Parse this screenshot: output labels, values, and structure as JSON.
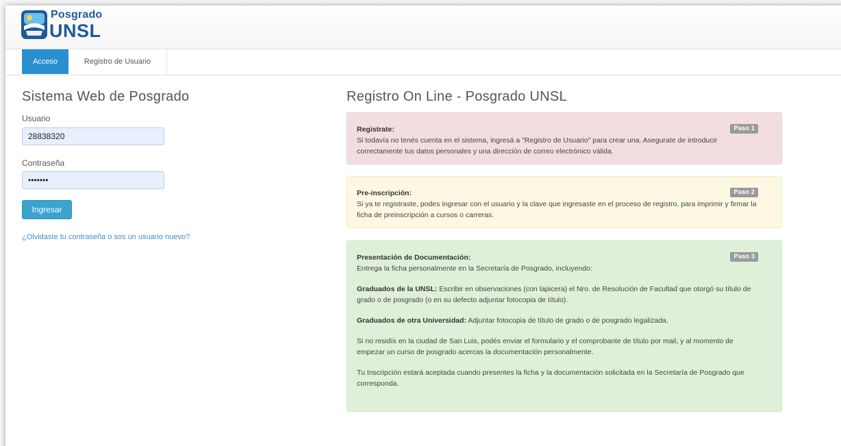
{
  "header": {
    "logo_top": "Posgrado",
    "logo_bottom": "UNSL"
  },
  "tabs": [
    {
      "label": "Acceso",
      "active": true
    },
    {
      "label": "Registro de Usuario",
      "active": false
    }
  ],
  "login": {
    "title": "Sistema Web de Posgrado",
    "user_label": "Usuario",
    "user_value": "28838320",
    "password_label": "Contraseña",
    "password_value": "•••••••",
    "submit_label": "Ingresar",
    "forgot_link": "¿Olvidaste tu contraseña o sos un usuario nuevo?"
  },
  "registro": {
    "title": "Registro On Line - Posgrado UNSL",
    "steps": [
      {
        "badge": "Paso 1",
        "title": "Registrate:",
        "text": "Si todavía no tenés cuenta en el sistema, ingresá a \"Registro de Usuario\" para crear una. Asegurate de introducir correctamente tus datos personales y una dirección de correo electrónico válida."
      },
      {
        "badge": "Paso 2",
        "title": "Pre-inscripción:",
        "text": "Si ya te registraste, podes ingresar con el usuario y la clave que ingresaste en el proceso de registro, para imprimir y firmar la ficha de preinscripción a cursos o carreras."
      },
      {
        "badge": "Paso 3",
        "title": "Presentación de Documentación:",
        "text": "Entrega la ficha personalmente en la Secretaría de Posgrado, incluyendo:",
        "grad_unsl_label": "Graduados de la UNSL:",
        "grad_unsl_text": "Escribir en observaciones (con lapicera) el Nro. de Resolución de Facultad que otorgó su título de grado o de posgrado (o en su defecto adjuntar fotocopia de título).",
        "grad_otra_label": "Graduados de otra Universidad:",
        "grad_otra_text": "Adjuntar fotocopia de título de grado o de posgrado legalizada.",
        "no_residis": "Si no residís en la ciudad de San Luis, podés enviar el formulario y el comprobante de título por mail, y al momento de empezar un curso de posgrado acercas la documentación personalmente.",
        "aceptada": "Tu Inscripción estará aceptada cuando presentes la ficha y la documentación solicitada en la Secretaría de Posgrado que corresponda."
      }
    ]
  },
  "colors": {
    "brand_blue": "#1e5a9c",
    "tab_active": "#2a8fd0",
    "button": "#3aa3cf",
    "step1_bg": "#f2dede",
    "step2_bg": "#fcf8e3",
    "step3_bg": "#dff0d8"
  }
}
